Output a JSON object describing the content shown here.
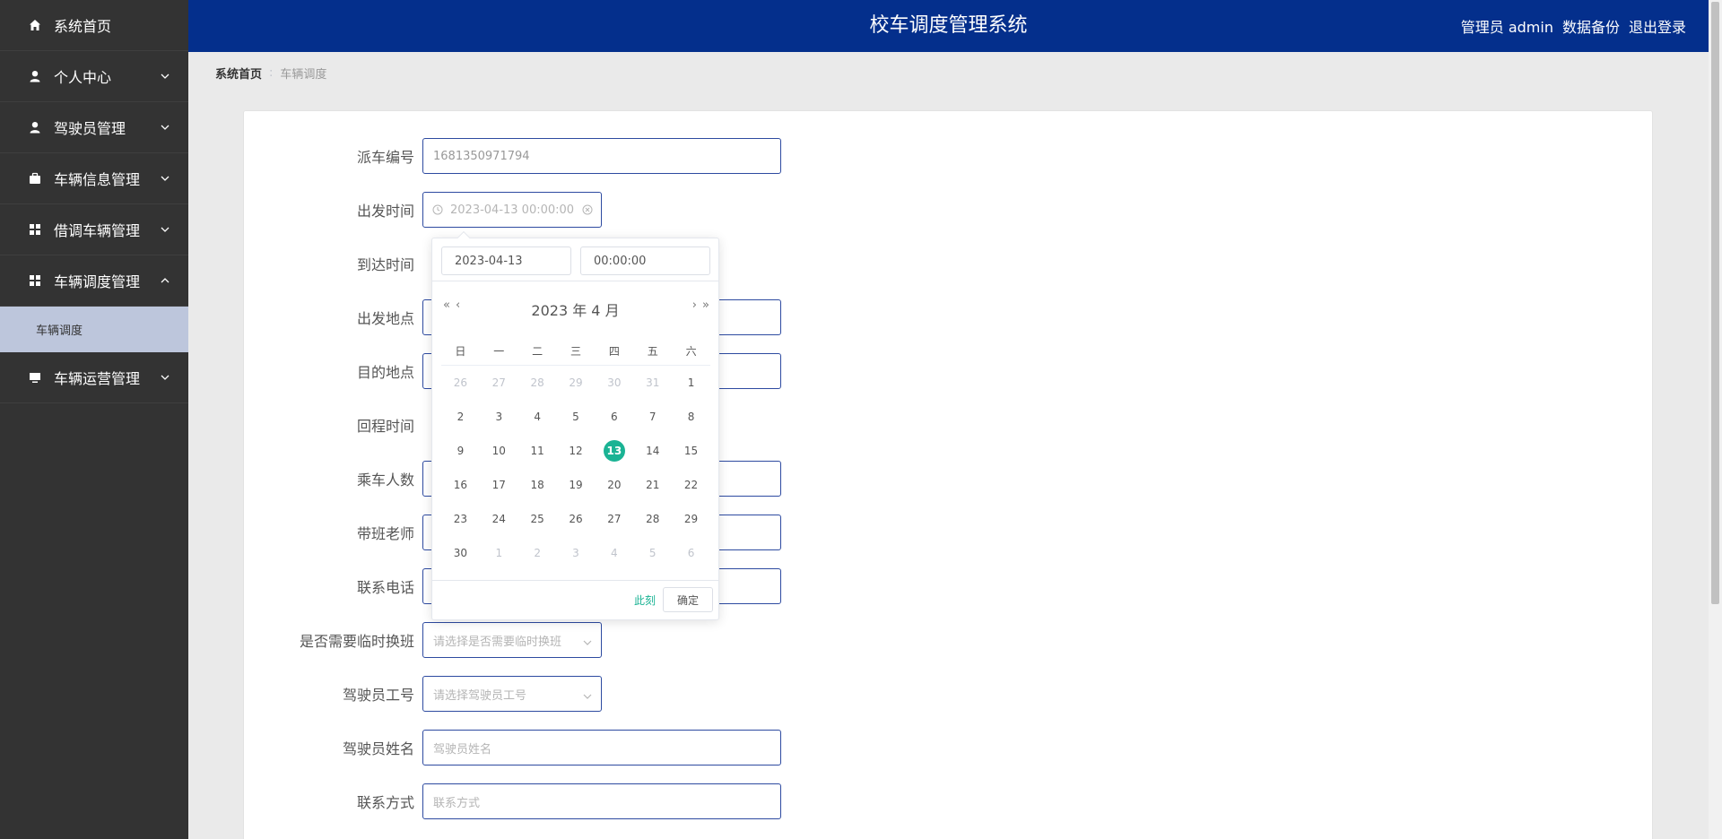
{
  "sidebar": {
    "items": [
      {
        "label": "系统首页",
        "icon": "home-icon"
      },
      {
        "label": "个人中心",
        "icon": "user-icon"
      },
      {
        "label": "驾驶员管理",
        "icon": "user-icon"
      },
      {
        "label": "车辆信息管理",
        "icon": "briefcase-icon"
      },
      {
        "label": "借调车辆管理",
        "icon": "grid-icon"
      },
      {
        "label": "车辆调度管理",
        "icon": "grid-icon"
      },
      {
        "label": "车辆运营管理",
        "icon": "monitor-icon"
      }
    ],
    "sub_item": {
      "label": "车辆调度"
    }
  },
  "header": {
    "title": "校车调度管理系统",
    "user": "管理员 admin",
    "backup": "数据备份",
    "logout": "退出登录"
  },
  "breadcrumb": {
    "home": "系统首页",
    "current": "车辆调度"
  },
  "form": {
    "dispatch_no": {
      "label": "派车编号",
      "value": "1681350971794"
    },
    "depart_time": {
      "label": "出发时间",
      "value": "2023-04-13 00:00:00"
    },
    "arrive_time": {
      "label": "到达时间"
    },
    "depart_place": {
      "label": "出发地点"
    },
    "dest_place": {
      "label": "目的地点"
    },
    "return_time": {
      "label": "回程时间"
    },
    "passengers": {
      "label": "乘车人数"
    },
    "teacher": {
      "label": "带班老师"
    },
    "phone": {
      "label": "联系电话"
    },
    "shift_change": {
      "label": "是否需要临时换班",
      "placeholder": "请选择是否需要临时换班"
    },
    "driver_no": {
      "label": "驾驶员工号",
      "placeholder": "请选择驾驶员工号"
    },
    "driver_name": {
      "label": "驾驶员姓名",
      "placeholder": "驾驶员姓名"
    },
    "contact": {
      "label": "联系方式",
      "placeholder": "联系方式"
    }
  },
  "picker": {
    "date": "2023-04-13",
    "time": "00:00:00",
    "title": "2023 年  4 月",
    "prev_year": "«",
    "prev_month": "‹",
    "next_month": "›",
    "next_year": "»",
    "weekdays": [
      "日",
      "一",
      "二",
      "三",
      "四",
      "五",
      "六"
    ],
    "days": [
      {
        "d": "26",
        "o": true
      },
      {
        "d": "27",
        "o": true
      },
      {
        "d": "28",
        "o": true
      },
      {
        "d": "29",
        "o": true
      },
      {
        "d": "30",
        "o": true
      },
      {
        "d": "31",
        "o": true
      },
      {
        "d": "1"
      },
      {
        "d": "2"
      },
      {
        "d": "3"
      },
      {
        "d": "4"
      },
      {
        "d": "5"
      },
      {
        "d": "6"
      },
      {
        "d": "7"
      },
      {
        "d": "8"
      },
      {
        "d": "9"
      },
      {
        "d": "10"
      },
      {
        "d": "11"
      },
      {
        "d": "12"
      },
      {
        "d": "13",
        "s": true
      },
      {
        "d": "14"
      },
      {
        "d": "15"
      },
      {
        "d": "16"
      },
      {
        "d": "17"
      },
      {
        "d": "18"
      },
      {
        "d": "19"
      },
      {
        "d": "20"
      },
      {
        "d": "21"
      },
      {
        "d": "22"
      },
      {
        "d": "23"
      },
      {
        "d": "24"
      },
      {
        "d": "25"
      },
      {
        "d": "26"
      },
      {
        "d": "27"
      },
      {
        "d": "28"
      },
      {
        "d": "29"
      },
      {
        "d": "30"
      },
      {
        "d": "1",
        "o": true
      },
      {
        "d": "2",
        "o": true
      },
      {
        "d": "3",
        "o": true
      },
      {
        "d": "4",
        "o": true
      },
      {
        "d": "5",
        "o": true
      },
      {
        "d": "6",
        "o": true
      }
    ],
    "now_label": "此刻",
    "ok_label": "确定"
  },
  "colors": {
    "header": "#042f8c",
    "sidebar": "#333333",
    "sub_active": "#bdc6dc",
    "accent": "#1ab394",
    "border": "#2d4aa0"
  }
}
